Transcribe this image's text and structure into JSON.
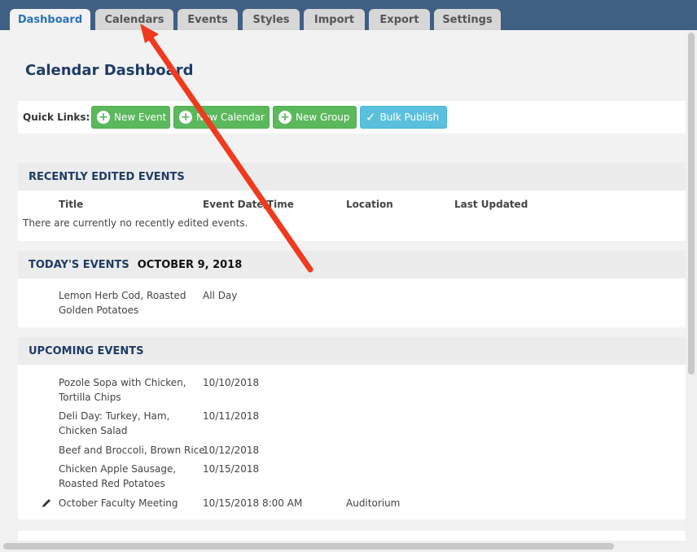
{
  "tabs": [
    {
      "label": "Dashboard",
      "active": true
    },
    {
      "label": "Calendars"
    },
    {
      "label": "Events"
    },
    {
      "label": "Styles"
    },
    {
      "label": "Import"
    },
    {
      "label": "Export"
    },
    {
      "label": "Settings"
    }
  ],
  "page": {
    "title": "Calendar Dashboard"
  },
  "quick_links": {
    "label": "Quick Links:",
    "buttons": [
      {
        "label": "New Event",
        "icon": "plus-circle-icon"
      },
      {
        "label": "New Calendar",
        "icon": "plus-circle-icon"
      },
      {
        "label": "New Group",
        "icon": "plus-circle-icon"
      },
      {
        "label": "Bulk Publish",
        "icon": "checkmark-icon"
      }
    ]
  },
  "recent": {
    "heading": "RECENTLY EDITED EVENTS",
    "columns": [
      "Title",
      "Event Date/Time",
      "Location",
      "Last Updated"
    ],
    "empty_text": "There are currently no recently edited events."
  },
  "today": {
    "heading": "TODAY'S EVENTS",
    "date": "OCTOBER 9, 2018",
    "events": [
      {
        "title_line1": "Lemon Herb Cod, Roasted",
        "title_line2": "Golden Potatoes",
        "when": "All Day"
      }
    ]
  },
  "upcoming": {
    "heading": "UPCOMING EVENTS",
    "events": [
      {
        "title_line1": "Pozole Sopa with Chicken,",
        "title_line2": "Tortilla Chips",
        "when": "10/10/2018",
        "location": ""
      },
      {
        "title_line1": "Deli Day: Turkey, Ham,",
        "title_line2": "Chicken Salad",
        "when": "10/11/2018",
        "location": ""
      },
      {
        "title_line1": "Beef and Broccoli, Brown Rice",
        "title_line2": "",
        "when": "10/12/2018",
        "location": ""
      },
      {
        "title_line1": "Chicken Apple Sausage,",
        "title_line2": "Roasted Red Potatoes",
        "when": "10/15/2018",
        "location": ""
      },
      {
        "title_line1": "October Faculty Meeting",
        "title_line2": "",
        "when": "10/15/2018 8:00 AM",
        "location": "Auditorium",
        "icon": "pencil-icon"
      }
    ]
  },
  "colors": {
    "tabbar": "#3f5f83",
    "active_tab_text": "#2a73b8",
    "heading": "#1f3c66",
    "green_button": "#5cb85c",
    "blue_button": "#5bc0de",
    "annotation_arrow": "#f03a1f"
  }
}
